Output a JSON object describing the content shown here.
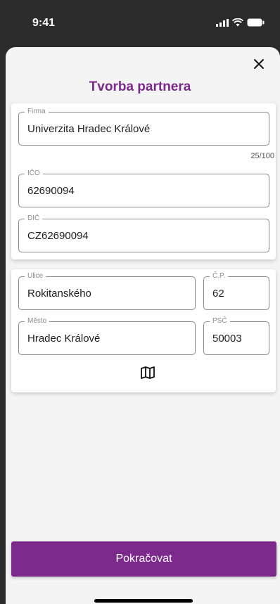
{
  "status_bar": {
    "time": "9:41"
  },
  "sheet": {
    "title": "Tvorba partnera"
  },
  "company_card": {
    "firma": {
      "label": "Firma",
      "value": "Univerzita Hradec Králové",
      "counter": "25/100"
    },
    "ico": {
      "label": "IČO",
      "value": "62690094"
    },
    "dic": {
      "label": "DIČ",
      "value": "CZ62690094"
    }
  },
  "address_card": {
    "ulice": {
      "label": "Ulice",
      "value": "Rokitanského"
    },
    "cp": {
      "label": "Č.P.",
      "value": "62"
    },
    "mesto": {
      "label": "Město",
      "value": "Hradec Králové"
    },
    "psc": {
      "label": "PSČ",
      "value": "50003"
    },
    "map_icon": "map-icon"
  },
  "footer": {
    "continue_label": "Pokračovat"
  },
  "colors": {
    "accent": "#7b2a8c",
    "background_dim": "#2b2b2b",
    "sheet": "#f4f4f4"
  }
}
